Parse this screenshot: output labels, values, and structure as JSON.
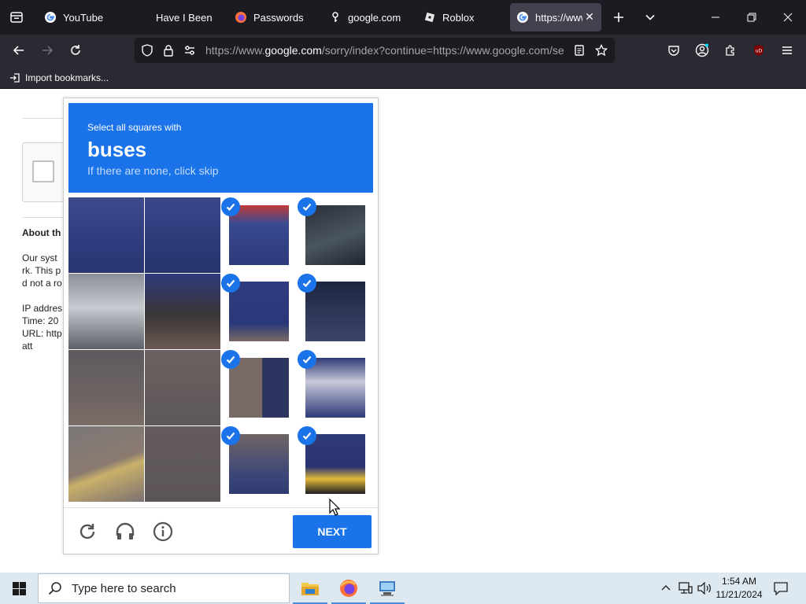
{
  "browser": {
    "tabs": [
      {
        "title": "YouTube",
        "icon": "google-icon"
      },
      {
        "title": "Have I Been Pwned",
        "icon": "none"
      },
      {
        "title": "Passwords",
        "icon": "firefox-icon"
      },
      {
        "title": "google.com –",
        "icon": "key-icon"
      },
      {
        "title": "Roblox",
        "icon": "roblox-icon"
      },
      {
        "title": "https://www.google.com",
        "icon": "google-icon",
        "active": true
      }
    ],
    "url_host": "https://www.",
    "url_domain": "google.com",
    "url_path": "/sorry/index?continue=https://www.google.com/se",
    "bookmark_label": "Import bookmarks..."
  },
  "page": {
    "heading": "About th",
    "lines": [
      "Our syst",
      "rk. This p",
      "d not a ro"
    ],
    "info": [
      "IP addres",
      "Time: 20",
      "URL: http",
      "att"
    ]
  },
  "captcha": {
    "instruction": "Select all squares with",
    "target": "buses",
    "hint": "If there are none, click skip",
    "next_label": "NEXT",
    "selected_tiles": [
      2,
      3,
      6,
      7,
      10,
      11,
      14,
      15
    ],
    "accent": "#1a73e8"
  },
  "taskbar": {
    "search_placeholder": "Type here to search",
    "time": "1:54 AM",
    "date": "11/21/2024"
  }
}
